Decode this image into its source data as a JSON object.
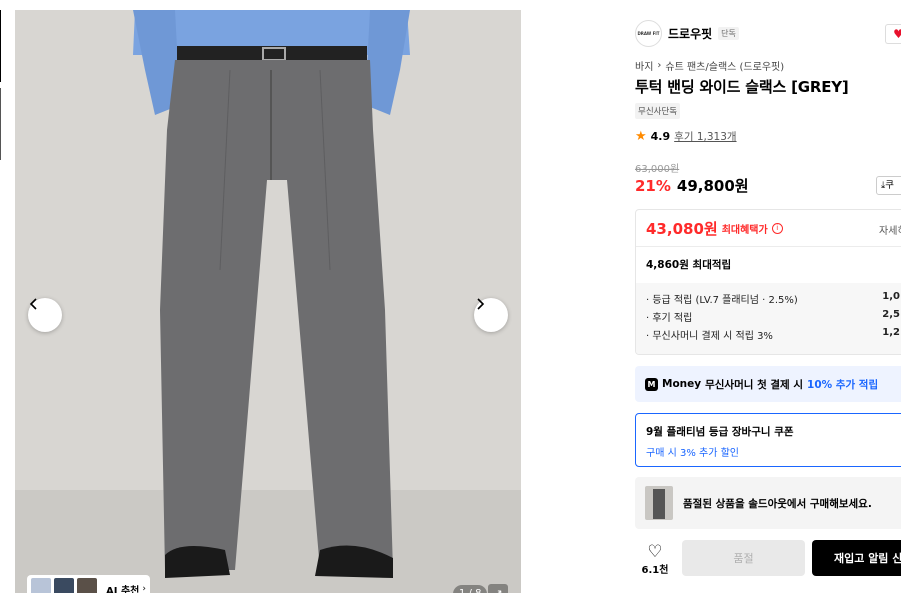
{
  "gallery": {
    "ai_chip_label": "AI 추천",
    "page_indicator": "1 / 8",
    "expand_icon": "expand-icon"
  },
  "brand": {
    "logo_text": "DRAW FIT",
    "name": "드로우핏",
    "tag": "단독"
  },
  "breadcrumb": {
    "category": "바지",
    "sub_category": "슈트 팬츠/슬랙스 (드로우핏)"
  },
  "product": {
    "title": "투턱 밴딩 와이드 슬랙스 [GREY]",
    "exclusive_badge": "무신사단독",
    "rating": "4.9",
    "review_link": "후기 1,313개",
    "original_price": "63,000원",
    "discount_rate": "21%",
    "sale_price": "49,800원",
    "coupon_label": "쿠"
  },
  "benefit": {
    "max_benefit_price": "43,080원",
    "max_benefit_label": "최대혜택가",
    "detail_link": "자세히",
    "points_title": "4,860원 최대적립",
    "points": [
      {
        "label": "· 등급 적립 (LV.7 플래티넘 · 2.5%)",
        "amount": "1,0"
      },
      {
        "label": "· 후기 적립",
        "amount": "2,5"
      },
      {
        "label": "· 무신사머니 결제 시 적립 3%",
        "amount": "1,2"
      }
    ]
  },
  "money_banner": {
    "logo": "M",
    "brand": "Money",
    "text": "무신사머니 첫 결제 시",
    "accent": "10% 추가 적립"
  },
  "coupon": {
    "title": "9월 플래티넘 등급 장바구니 쿠폰",
    "subtitle": "구매 시 3% 추가 할인"
  },
  "soldout_notice": {
    "message": "품절된 상품을 솔드아웃에서 구매해보세요."
  },
  "actions": {
    "wish_count": "6.1천",
    "soldout_label": "품절",
    "restock_label": "재입고 알림 신"
  },
  "colors": {
    "accent_red": "#ff2a2a",
    "accent_blue": "#1a66ff",
    "primary_black": "#000000"
  }
}
